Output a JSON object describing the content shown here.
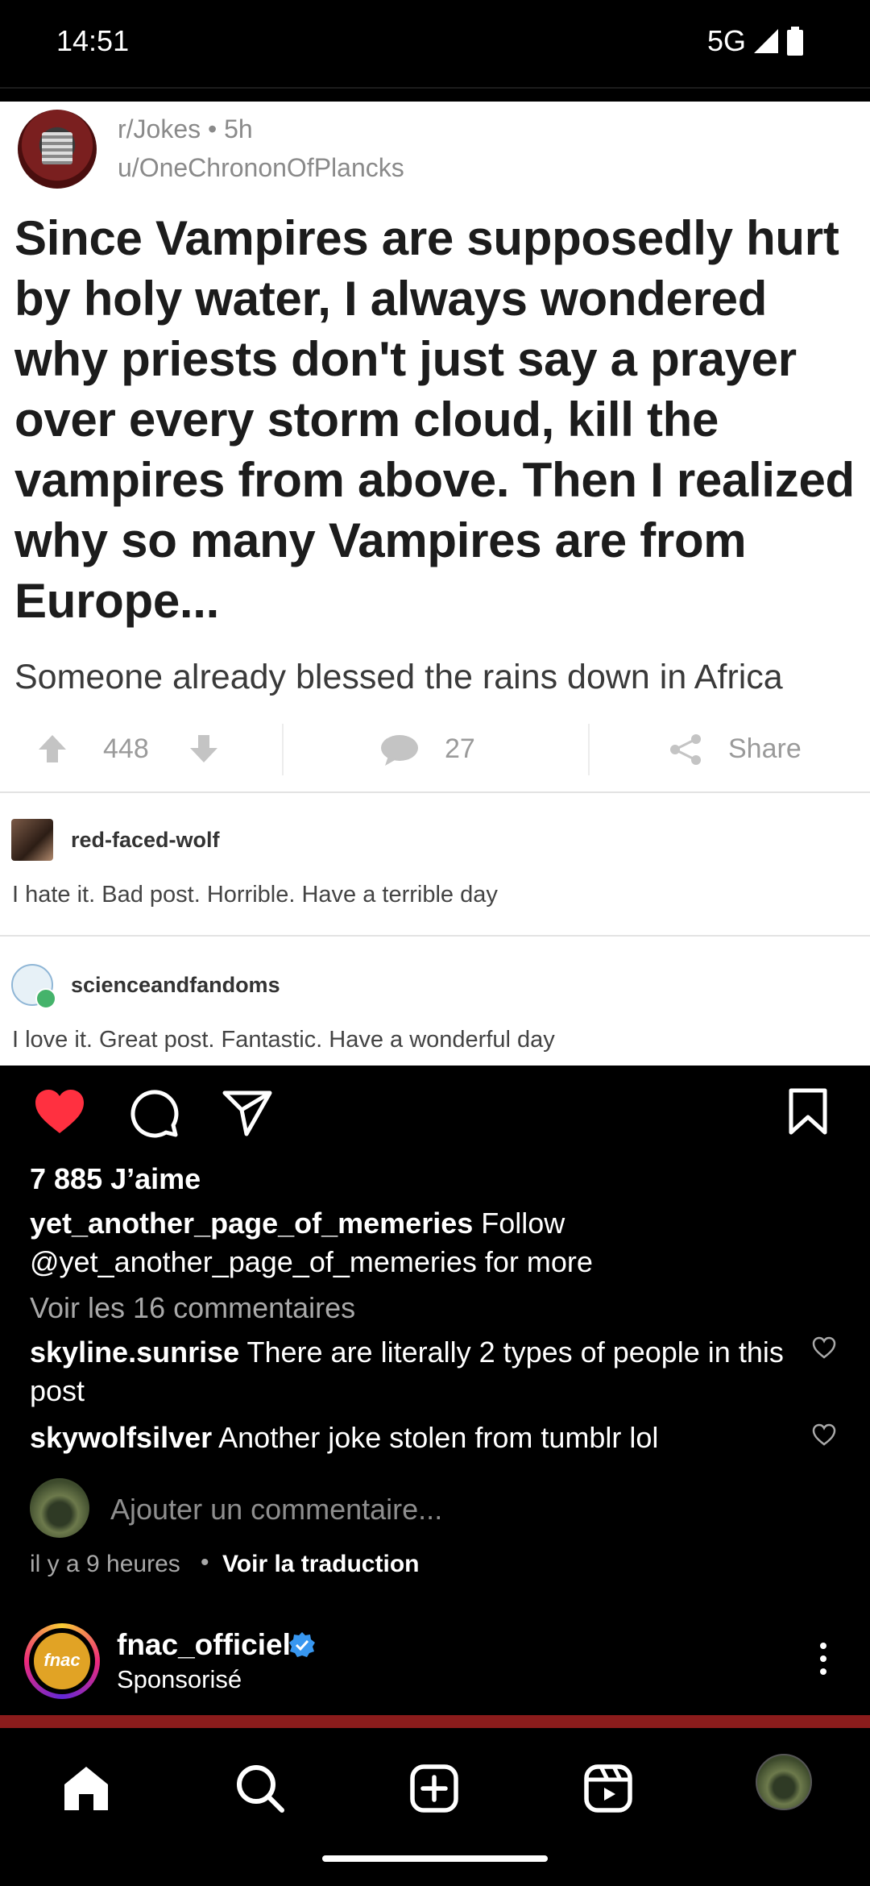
{
  "status_bar": {
    "time": "14:51",
    "network": "5G"
  },
  "meme": {
    "subreddit_line": "r/Jokes • 5h",
    "user_line": "u/OneChrononOfPlancks",
    "title": "Since Vampires are supposedly hurt by holy water, I always wondered why priests don't just say a prayer over every storm cloud, kill the vampires from above. Then I realized why so many Vampires are from Europe...",
    "body": "Someone already blessed the rains down in Africa",
    "upvotes": "448",
    "comments_count": "27",
    "share_label": "Share",
    "comments": [
      {
        "user": "red-faced-wolf",
        "text": "I hate it. Bad post. Horrible. Have a terrible day"
      },
      {
        "user": "scienceandfandoms",
        "text": "I love it. Great post. Fantastic. Have a wonderful day"
      }
    ]
  },
  "post": {
    "liked": true,
    "likes": "7 885 J’aime",
    "caption_user": "yet_another_page_of_memeries",
    "caption_text": "Follow @yet_another_page_of_memeries for more",
    "view_comments": "Voir les 16 commentaires",
    "comments": [
      {
        "user": "skyline.sunrise",
        "text": "There are literally 2 types of people in this post"
      },
      {
        "user": "skywolfsilver",
        "text": "Another joke stolen from tumblr lol"
      }
    ],
    "add_comment_placeholder": "Ajouter un commentaire...",
    "time_ago": "il y a 9 heures",
    "separator": "•",
    "see_translation": "Voir la traduction"
  },
  "sponsored": {
    "logo_text": "fnac",
    "account": "fnac_officiel",
    "label": "Sponsorisé"
  },
  "nav": {
    "items": [
      "home-icon",
      "search-icon",
      "create-icon",
      "reels-icon",
      "profile-avatar"
    ]
  },
  "colors": {
    "like_red": "#ff3040",
    "verified_blue": "#3897f0"
  }
}
